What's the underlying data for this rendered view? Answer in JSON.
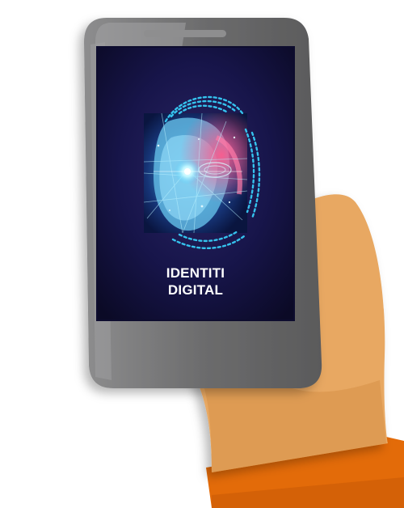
{
  "screen": {
    "title_line1": "IDENTITI",
    "title_line2": "DIGITAL"
  },
  "icons": {
    "phone": "smartphone-icon",
    "face_scan": "face-fingerprint-scan-icon",
    "home_button": "home-button-icon"
  },
  "colors": {
    "skin": "#E8A862",
    "skin_shadow": "#D68F47",
    "fingernail": "#FFFFFF",
    "phone_body": "#6F6F70",
    "phone_frame_light": "#9A9A9B",
    "screen_background": "#12103A",
    "sleeve": "#E36B09",
    "cyan_glow": "#38C8F0",
    "magenta_glow": "#E03C7A",
    "title_text": "#FFFFFF"
  }
}
